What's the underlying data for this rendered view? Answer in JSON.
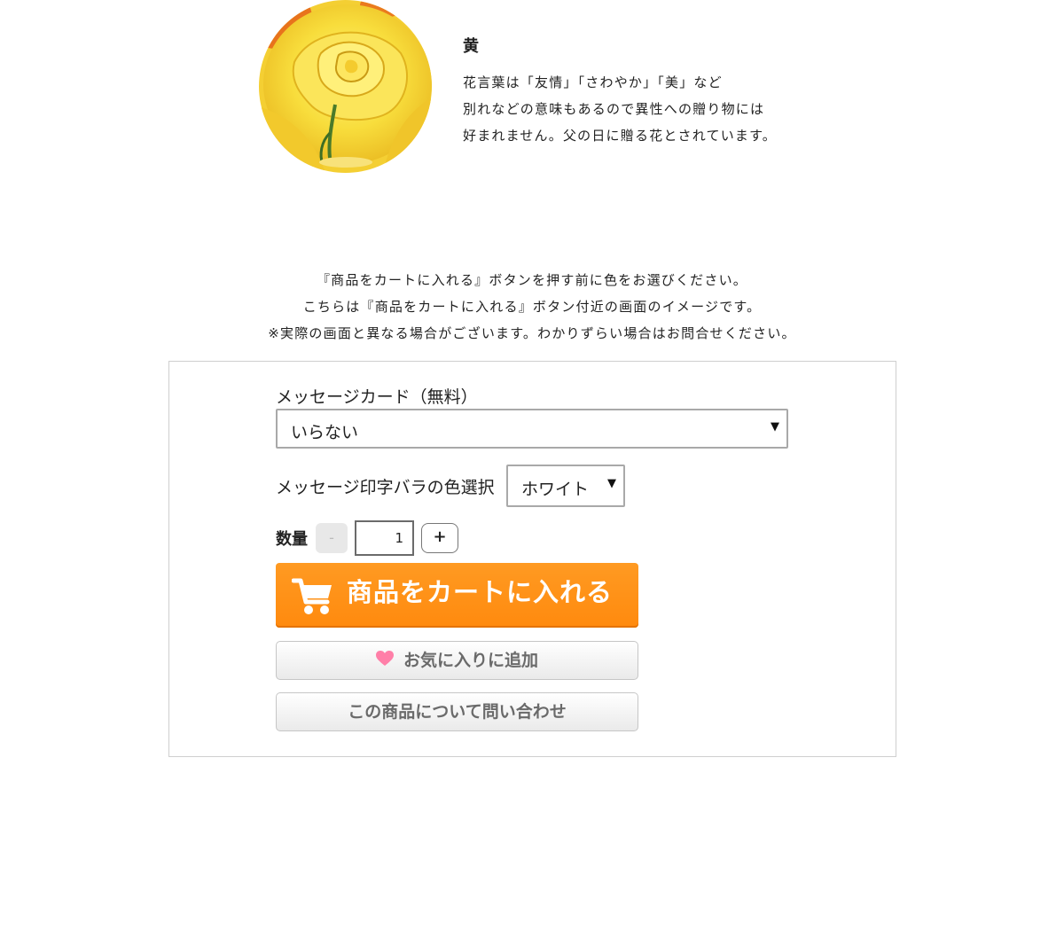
{
  "color_section": {
    "name": "黄",
    "description_lines": [
      "花言葉は「友情」「さわやか」「美」など",
      "別れなどの意味もあるので異性への贈り物には",
      "好まれません。父の日に贈る花とされています。"
    ]
  },
  "notice": {
    "lines": [
      "『商品をカートに入れる』ボタンを押す前に色をお選びください。",
      "こちらは『商品をカートに入れる』ボタン付近の画面のイメージです。",
      "※実際の画面と異なる場合がございます。わかりずらい場合はお問合せください。"
    ]
  },
  "purchase_form": {
    "message_card_label": "メッセージカード（無料）",
    "message_card_value": "いらない",
    "rose_color_label": "メッセージ印字バラの色選択",
    "rose_color_value": "ホワイト",
    "select_arrow": "▼",
    "quantity_label": "数量",
    "quantity_minus": "-",
    "quantity_value": "1",
    "quantity_plus": "+",
    "cart_button_label": "商品をカートに入れる",
    "favorite_button_label": "お気に入りに追加",
    "inquiry_button_label": "この商品について問い合わせ"
  },
  "colors": {
    "cart_button": "#ff8c11",
    "heart": "#ff7fa8",
    "rose": "#f7dc3a"
  }
}
